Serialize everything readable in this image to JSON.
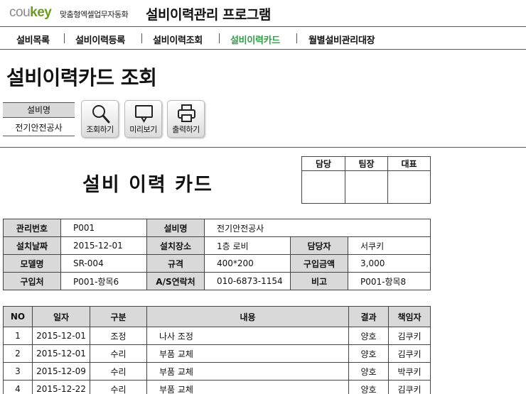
{
  "brand": {
    "logo_prefix": "cou",
    "logo_suffix": "key",
    "tagline": "맞춤형엑셀업무자동화",
    "app_title": "설비이력관리 프로그램"
  },
  "nav": {
    "items": [
      {
        "label": "설비목록",
        "active": false
      },
      {
        "label": "설비이력등록",
        "active": false
      },
      {
        "label": "설비이력조회",
        "active": false
      },
      {
        "label": "설비이력카드",
        "active": true
      },
      {
        "label": "월별설비관리대장",
        "active": false
      }
    ],
    "active_color": "#2f9f46"
  },
  "page": {
    "title": "설비이력카드 조회"
  },
  "filter": {
    "label": "설비명",
    "value": "전기안전공사"
  },
  "toolbar": {
    "search_label": "조회하기",
    "search_icon": "magnifier-icon",
    "preview_label": "미리보기",
    "preview_icon": "monitor-icon",
    "print_label": "출력하기",
    "print_icon": "printer-icon"
  },
  "card": {
    "title": "설비 이력 카드",
    "approval": [
      "담당",
      "팀장",
      "대표"
    ]
  },
  "info": {
    "mgmt_no_label": "관리번호",
    "mgmt_no": "P001",
    "equip_name_label": "설비명",
    "equip_name": "전기안전공사",
    "install_date_label": "설치날짜",
    "install_date": "2015-12-01",
    "install_place_label": "설치장소",
    "install_place": "1층 로비",
    "manager_label": "담당자",
    "manager": "서쿠키",
    "model_label": "모델명",
    "model": "SR-004",
    "spec_label": "규격",
    "spec": "400*200",
    "price_label": "구입금액",
    "price": "3,000",
    "vendor_label": "구입처",
    "vendor": "P001-항목6",
    "as_contact_label": "A/S연락처",
    "as_contact": "010-6873-1154",
    "note_label": "비고",
    "note": "P001-항목8"
  },
  "history": {
    "headers": [
      "NO",
      "일자",
      "구분",
      "내용",
      "결과",
      "책임자"
    ],
    "rows": [
      [
        "1",
        "2015-12-01",
        "조정",
        "나사 조정",
        "양호",
        "김쿠키"
      ],
      [
        "2",
        "2015-12-01",
        "수리",
        "부품 교체",
        "양호",
        "김쿠키"
      ],
      [
        "3",
        "2015-12-09",
        "수리",
        "부품 교체",
        "양호",
        "박쿠키"
      ],
      [
        "4",
        "2015-12-22",
        "수리",
        "부품 교체",
        "양호",
        "김쿠키"
      ]
    ]
  }
}
